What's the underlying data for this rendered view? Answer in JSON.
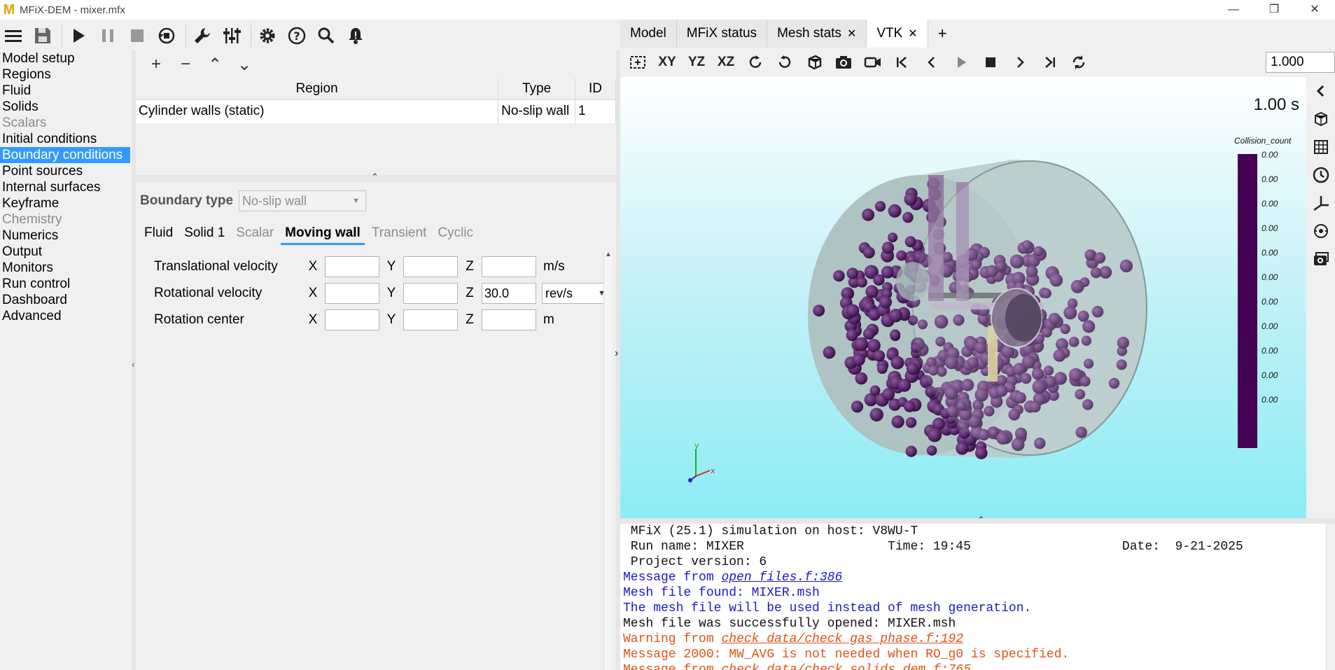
{
  "window": {
    "title": "MFiX-DEM - mixer.mfx",
    "controls": [
      "minimize",
      "maximize",
      "close"
    ]
  },
  "toolbar": {
    "buttons": [
      "menu-icon",
      "save-icon",
      "run-icon",
      "pause-icon",
      "stop-icon",
      "reset-icon",
      "build-icon",
      "solver-settings-icon",
      "settings-icon",
      "help-icon",
      "search-icon",
      "notifications-icon"
    ]
  },
  "nav": {
    "items": [
      {
        "label": "Model setup",
        "state": "enabled"
      },
      {
        "label": "Regions",
        "state": "enabled"
      },
      {
        "label": "Fluid",
        "state": "enabled"
      },
      {
        "label": "Solids",
        "state": "enabled"
      },
      {
        "label": "Scalars",
        "state": "disabled"
      },
      {
        "label": "Initial conditions",
        "state": "enabled"
      },
      {
        "label": "Boundary conditions",
        "state": "selected"
      },
      {
        "label": "Point sources",
        "state": "enabled"
      },
      {
        "label": "Internal surfaces",
        "state": "enabled"
      },
      {
        "label": "Keyframe",
        "state": "enabled"
      },
      {
        "label": "Chemistry",
        "state": "disabled"
      },
      {
        "label": "Numerics",
        "state": "enabled"
      },
      {
        "label": "Output",
        "state": "enabled"
      },
      {
        "label": "Monitors",
        "state": "enabled"
      },
      {
        "label": "Run control",
        "state": "enabled"
      },
      {
        "label": "Dashboard",
        "state": "enabled"
      },
      {
        "label": "Advanced",
        "state": "enabled"
      }
    ]
  },
  "regions": {
    "tools": [
      "+",
      "−",
      "⌃",
      "⌄"
    ],
    "columns": [
      "Region",
      "Type",
      "ID"
    ],
    "rows": [
      {
        "region": "Cylinder walls (static)",
        "type": "No-slip wall",
        "id": "1"
      }
    ]
  },
  "bc": {
    "type_label": "Boundary type",
    "type_value": "No-slip wall",
    "tabs": [
      {
        "label": "Fluid",
        "state": "enabled"
      },
      {
        "label": "Solid 1",
        "state": "enabled"
      },
      {
        "label": "Scalar",
        "state": "disabled"
      },
      {
        "label": "Moving wall",
        "state": "active"
      },
      {
        "label": "Transient",
        "state": "disabled"
      },
      {
        "label": "Cyclic",
        "state": "disabled"
      }
    ],
    "rows": [
      {
        "label": "Translational velocity",
        "x": "",
        "y": "",
        "z": "",
        "unit": "m/s"
      },
      {
        "label": "Rotational velocity",
        "x": "",
        "y": "",
        "z": "30.0",
        "unit": "rev/s"
      },
      {
        "label": "Rotation center",
        "x": "",
        "y": "",
        "z": "",
        "unit": "m"
      }
    ],
    "axes": [
      "X",
      "Y",
      "Z"
    ]
  },
  "right_tabs": [
    {
      "label": "Model",
      "closable": false,
      "active": false
    },
    {
      "label": "MFiX status",
      "closable": false,
      "active": false
    },
    {
      "label": "Mesh stats",
      "closable": true,
      "active": false
    },
    {
      "label": "VTK",
      "closable": true,
      "active": true
    }
  ],
  "vtk": {
    "toolbar": [
      "reset-view-icon",
      "XY",
      "YZ",
      "XZ",
      "rotate-left-icon",
      "rotate-right-icon",
      "perspective-icon",
      "screenshot-icon",
      "record-icon",
      "first-frame-icon",
      "prev-frame-icon",
      "play-icon",
      "stop-icon",
      "next-frame-icon",
      "last-frame-icon",
      "repeat-icon"
    ],
    "time_value": "1.000",
    "sim_time": "1.00 s",
    "colorbar_title": "Collision_count",
    "colorbar_color": "#440154",
    "colorbar_ticks": [
      "0.00",
      "0.00",
      "0.00",
      "0.00",
      "0.00",
      "0.00",
      "0.00",
      "0.00",
      "0.00",
      "0.00",
      "0.00"
    ],
    "axes_labels": [
      "y",
      "x"
    ]
  },
  "console": {
    "lines": [
      {
        "text": " MFiX (25.1) simulation on host: V8WU-T",
        "color": "black"
      },
      {
        "text": " Run name: MIXER                   Time: 19:45                    Date:  9-21-2025",
        "color": "black"
      },
      {
        "text": " Project version: 6",
        "color": "black"
      },
      {
        "prefix": "Message from ",
        "link": "open_files.f:386",
        "color": "blue"
      },
      {
        "text": "Mesh file found: MIXER.msh",
        "color": "blue"
      },
      {
        "text": "The mesh file will be used instead of mesh generation.",
        "color": "blue"
      },
      {
        "text": "Mesh file was successfully opened: MIXER.msh",
        "color": "black"
      },
      {
        "prefix": "Warning from ",
        "link": "check_data/check_gas_phase.f:192",
        "color": "orange"
      },
      {
        "text": "Message 2000: MW_AVG is not needed when RO_g0 is specified.",
        "color": "orange"
      },
      {
        "prefix": "Message from ",
        "link": "check_data/check_solids_dem.f:765",
        "color": "orange"
      }
    ]
  }
}
